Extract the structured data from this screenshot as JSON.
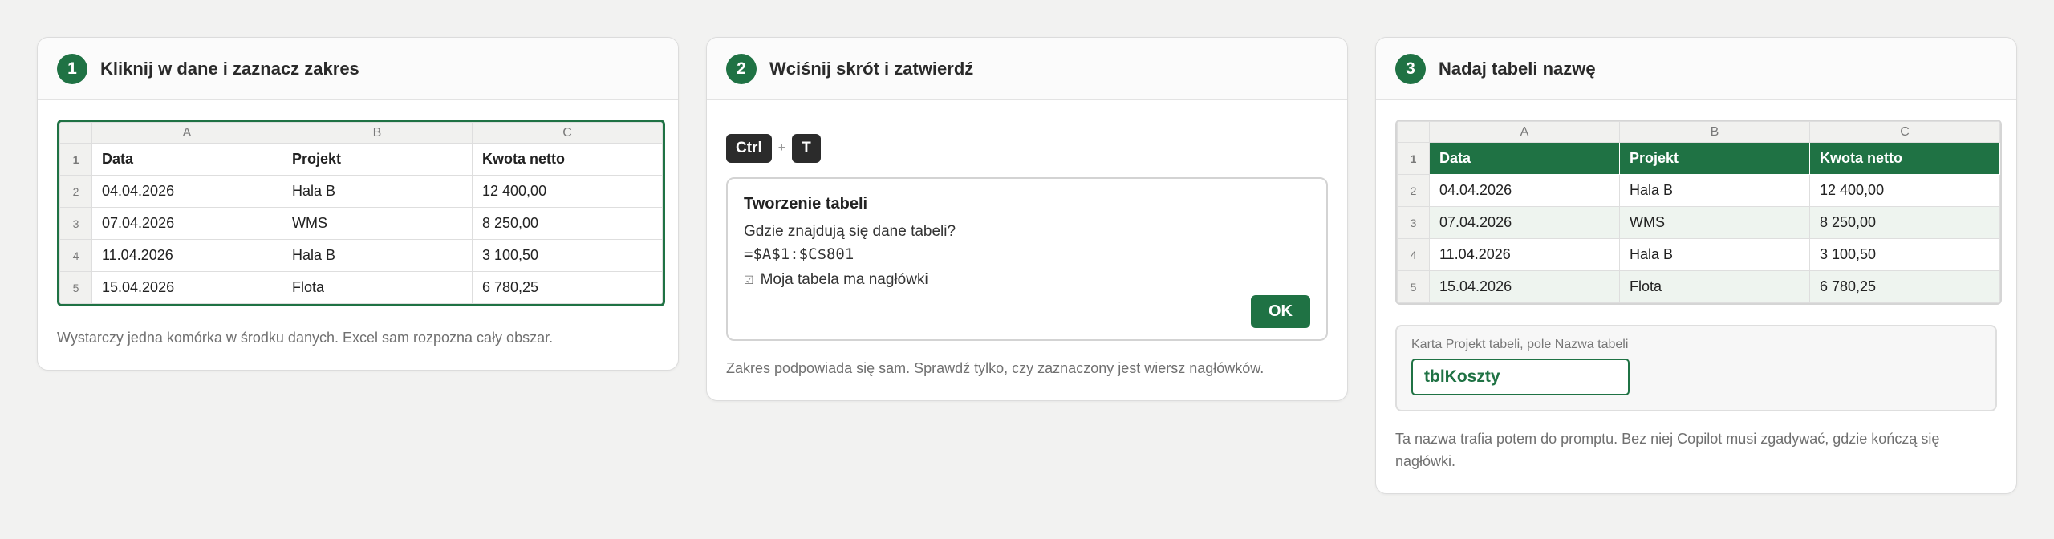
{
  "columns": [
    "A",
    "B",
    "C"
  ],
  "steps": [
    {
      "number": "1",
      "title": "Kliknij w dane i zaznacz zakres",
      "caption": "Wystarczy jedna komórka w środku danych. Excel sam rozpozna cały obszar."
    },
    {
      "number": "2",
      "title": "Wciśnij skrót i zatwierdź",
      "caption": "Zakres podpowiada się sam. Sprawdź tylko, czy zaznaczony jest wiersz nagłówków."
    },
    {
      "number": "3",
      "title": "Nadaj tabeli nazwę",
      "caption": "Ta nazwa trafia potem do promptu. Bez niej Copilot musi zgadywać, gdzie kończą się nagłówki."
    }
  ],
  "sheet": {
    "rows": [
      {
        "n": "1",
        "cells": [
          "Data",
          "Projekt",
          "Kwota netto"
        ]
      },
      {
        "n": "2",
        "cells": [
          "04.04.2026",
          "Hala B",
          "12 400,00"
        ]
      },
      {
        "n": "3",
        "cells": [
          "07.04.2026",
          "WMS",
          "8 250,00"
        ]
      },
      {
        "n": "4",
        "cells": [
          "11.04.2026",
          "Hala B",
          "3 100,50"
        ]
      },
      {
        "n": "5",
        "cells": [
          "15.04.2026",
          "Flota",
          "6 780,25"
        ]
      }
    ]
  },
  "shortcut": {
    "key1": "Ctrl",
    "plus": "+",
    "key2": "T"
  },
  "dialog": {
    "title": "Tworzenie tabeli",
    "question": "Gdzie znajdują się dane tabeli?",
    "range": "=$A$1:$C$801",
    "checkbox_glyph": "☑",
    "checkbox_label": "Moja tabela ma nagłówki",
    "ok_label": "OK"
  },
  "name_box": {
    "label": "Karta Projekt tabeli, pole Nazwa tabeli",
    "value": "tblKoszty"
  },
  "colors": {
    "accent": "#1f7244",
    "band": "#eef4ef",
    "background": "#f2f2f1"
  }
}
